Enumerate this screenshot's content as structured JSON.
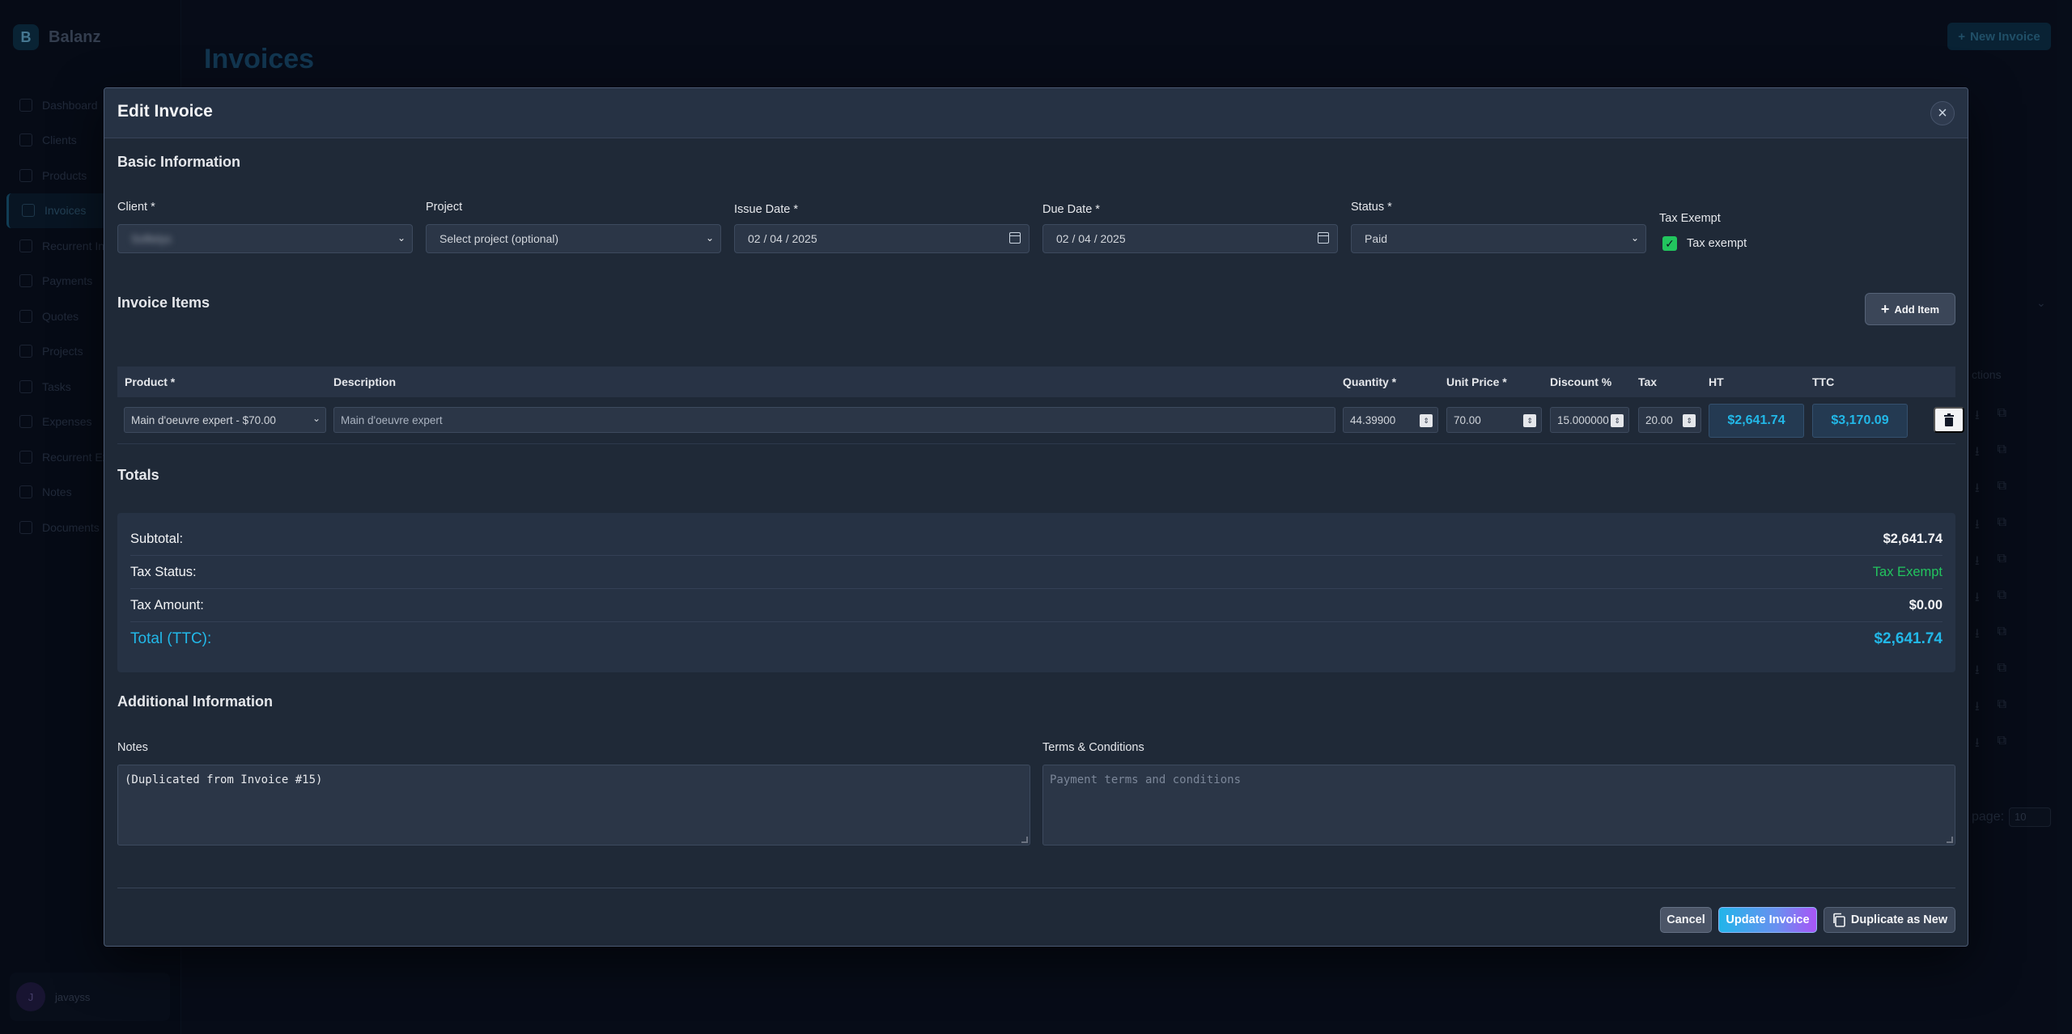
{
  "app": {
    "brand_initial": "B",
    "brand_name": "Balanz",
    "page_title": "Invoices",
    "new_invoice_label": "New Invoice",
    "nav": [
      {
        "label": "Dashboard",
        "icon": "home-icon"
      },
      {
        "label": "Clients",
        "icon": "users-icon"
      },
      {
        "label": "Products",
        "icon": "box-icon"
      },
      {
        "label": "Invoices",
        "icon": "file-icon"
      },
      {
        "label": "Recurrent In",
        "icon": "repeat-icon"
      },
      {
        "label": "Payments",
        "icon": "dollar-icon"
      },
      {
        "label": "Quotes",
        "icon": "quote-icon"
      },
      {
        "label": "Projects",
        "icon": "folder-icon"
      },
      {
        "label": "Tasks",
        "icon": "check-icon"
      },
      {
        "label": "Expenses",
        "icon": "receipt-icon"
      },
      {
        "label": "Recurrent Ex",
        "icon": "repeat-icon"
      },
      {
        "label": "Notes",
        "icon": "pencil-icon"
      },
      {
        "label": "Documents",
        "icon": "folder-icon"
      }
    ],
    "active_nav_index": 3,
    "user_initial": "J",
    "user_name": "javayss",
    "bg_actions_head": "ctions",
    "bg_perpage_label": "page:",
    "bg_perpage_value": "10"
  },
  "modal": {
    "title": "Edit Invoice",
    "basic": {
      "title": "Basic Information",
      "client_label": "Client *",
      "client_value": "Softelys",
      "project_label": "Project",
      "project_value": "Select project (optional)",
      "issue_label": "Issue Date *",
      "issue_value": "02 / 04 / 2025",
      "due_label": "Due Date *",
      "due_value": "02 / 04 / 2025",
      "status_label": "Status *",
      "status_value": "Paid",
      "tax_exempt_label": "Tax Exempt",
      "tax_exempt_checkbox_label": "Tax exempt",
      "tax_exempt_checked": true
    },
    "items": {
      "title": "Invoice Items",
      "add_label": "Add Item",
      "columns": [
        "Product *",
        "Description",
        "Quantity *",
        "Unit Price *",
        "Discount %",
        "Tax",
        "HT",
        "TTC"
      ],
      "rows": [
        {
          "product": "Main d'oeuvre expert - $70.00",
          "description": "Main d'oeuvre expert",
          "quantity": "44.39900",
          "unit_price": "70.00",
          "discount": "15.000000",
          "tax": "20.00",
          "ht": "$2,641.74",
          "ttc": "$3,170.09"
        }
      ]
    },
    "totals": {
      "title": "Totals",
      "subtotal_label": "Subtotal:",
      "subtotal_value": "$2,641.74",
      "tax_status_label": "Tax Status:",
      "tax_status_value": "Tax Exempt",
      "tax_amount_label": "Tax Amount:",
      "tax_amount_value": "$0.00",
      "total_label": "Total (TTC):",
      "total_value": "$2,641.74"
    },
    "additional": {
      "title": "Additional Information",
      "notes_label": "Notes",
      "notes_value": "(Duplicated from Invoice #15)",
      "terms_label": "Terms & Conditions",
      "terms_placeholder": "Payment terms and conditions"
    },
    "footer": {
      "cancel": "Cancel",
      "update": "Update Invoice",
      "duplicate": "Duplicate as New"
    }
  },
  "colors": {
    "accent": "#22b8e8",
    "success": "#22c55e",
    "modal_bg": "#1f2937"
  }
}
